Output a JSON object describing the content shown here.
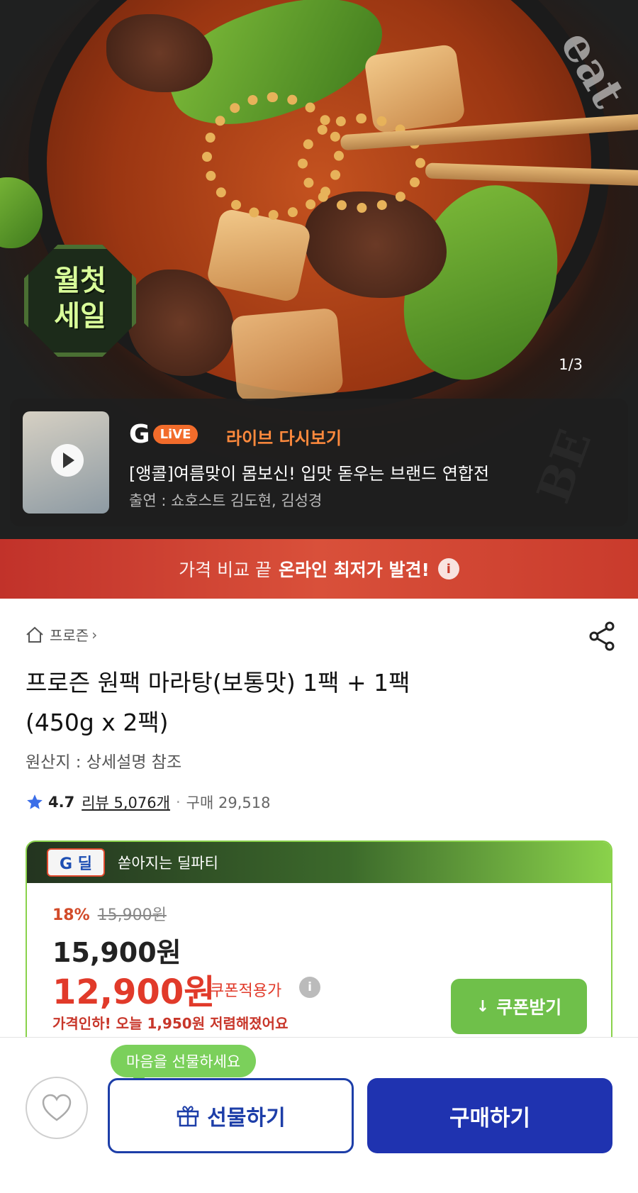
{
  "hero": {
    "page_counter": "1/3",
    "badge_line1": "월첫",
    "badge_line2": "세일"
  },
  "live": {
    "logo_g": "G",
    "logo_pill": "LiVE",
    "replay_label": "라이브 다시보기",
    "title": "[앵콜]여름맞이 몸보신! 입맛 돋우는 브랜드 연합전",
    "cast": "출연 : 쇼호스트 김도현, 김성경"
  },
  "promo": {
    "text_light": "가격 비교 끝",
    "text_strong": "온라인 최저가 발견!",
    "info_icon": "i"
  },
  "breadcrumb": {
    "label": "프로즌",
    "chevron": "›"
  },
  "product": {
    "title_line1": "프로즌 원팩 마라탕(보통맛) 1팩 + 1팩",
    "title_line2": "(450g x 2팩)",
    "origin": "원산지 : 상세설명 참조",
    "rating": "4.7",
    "review": "리뷰 5,076개",
    "dot": "·",
    "purchases": "구매 29,518"
  },
  "deal": {
    "badge": "G 딜",
    "header": "쏟아지는 딜파티",
    "discount_pct": "18%",
    "original_price": "15,900원",
    "price": "15,900원",
    "coupon_price": "12,900원",
    "coupon_label": "쿠폰적용가",
    "info_icon": "i",
    "price_drop": "가격인하! 오늘 1,950원 저렴해졌어요",
    "coupon_button": "쿠폰받기",
    "download_icon": "↓"
  },
  "bottom": {
    "gift_tip": "마음을 선물하세요",
    "gift_button": "선물하기",
    "buy_button": "구매하기"
  },
  "colors": {
    "brand_blue": "#1f33b0",
    "price_red": "#e13a2a",
    "deal_green": "#6fc04a",
    "promo_red": "#c93b2c"
  }
}
